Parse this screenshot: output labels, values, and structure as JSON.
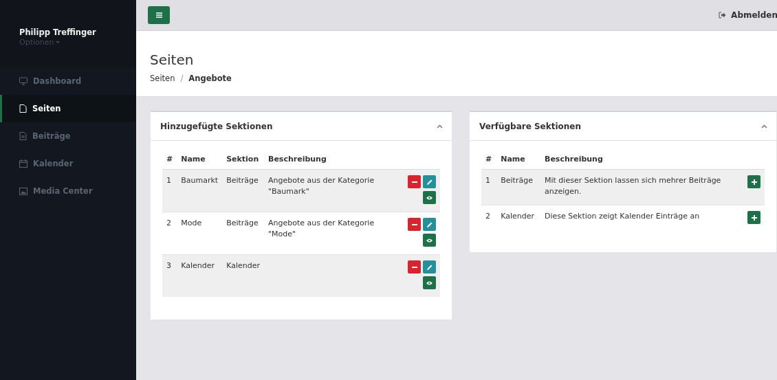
{
  "sidebar": {
    "user": "Philipp Treffinger",
    "options": "Optionen",
    "items": [
      {
        "label": "Dashboard",
        "kind": "monitor",
        "selected": false
      },
      {
        "label": "Seiten",
        "kind": "page",
        "selected": true
      },
      {
        "label": "Beiträge",
        "kind": "doc",
        "selected": false
      },
      {
        "label": "Kalender",
        "kind": "calendar",
        "selected": false
      },
      {
        "label": "Media Center",
        "kind": "image",
        "selected": false
      }
    ]
  },
  "topbar": {
    "logout": "Abmelden"
  },
  "page": {
    "title": "Seiten",
    "breadcrumb": [
      "Seiten",
      "Angebote"
    ],
    "separator": "/"
  },
  "panels": [
    {
      "title": "Hinzugefügte Sektionen",
      "kind": "added",
      "columns": [
        "#",
        "Name",
        "Sektion",
        "Beschreibung"
      ],
      "rows": [
        {
          "cells": [
            "1",
            "Baumarkt",
            "Beiträge",
            "Angebote aus der Kategorie \"Baumark\""
          ]
        },
        {
          "cells": [
            "2",
            "Mode",
            "Beiträge",
            "Angebote aus der Kategorie \"Mode\""
          ]
        },
        {
          "cells": [
            "3",
            "Kalender",
            "Kalender",
            ""
          ]
        }
      ]
    },
    {
      "title": "Verfügbare Sektionen",
      "kind": "available",
      "columns": [
        "#",
        "Name",
        "Beschreibung"
      ],
      "rows": [
        {
          "cells": [
            "1",
            "Beiträge",
            "Mit dieser Sektion lassen sich mehrer Beiträge anzeigen."
          ]
        },
        {
          "cells": [
            "2",
            "Kalender",
            "Diese Sektion zeigt Kalender Einträge an"
          ]
        }
      ]
    }
  ]
}
